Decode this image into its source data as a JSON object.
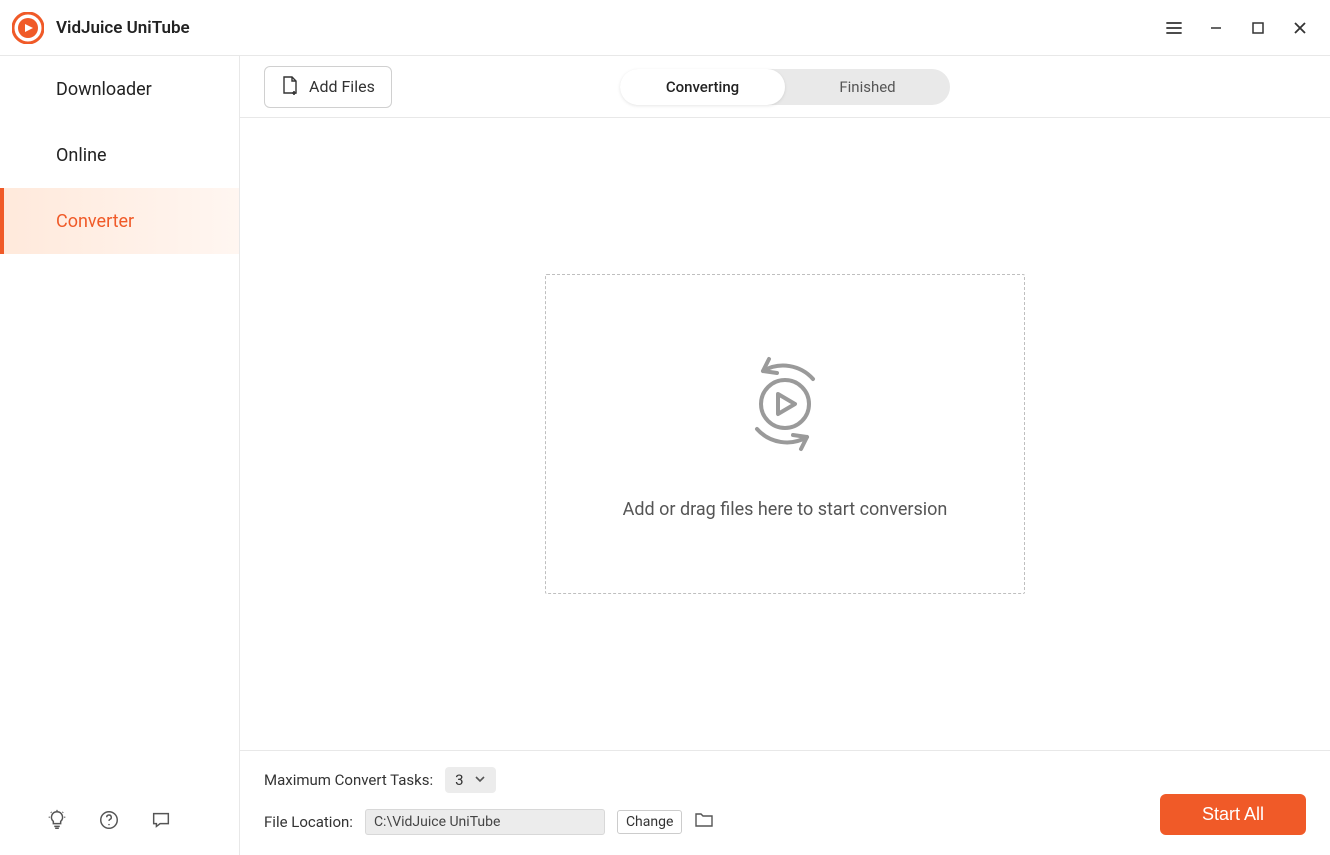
{
  "app_title": "VidJuice UniTube",
  "sidebar": {
    "items": [
      {
        "label": "Downloader",
        "active": false
      },
      {
        "label": "Online",
        "active": false
      },
      {
        "label": "Converter",
        "active": true
      }
    ]
  },
  "toolbar": {
    "add_files_label": "Add Files",
    "tabs": {
      "converting": "Converting",
      "finished": "Finished"
    }
  },
  "dropzone": {
    "hint": "Add or drag files here to start conversion"
  },
  "bottom": {
    "max_tasks_label": "Maximum Convert Tasks:",
    "max_tasks_value": "3",
    "file_location_label": "File Location:",
    "file_location_value": "C:\\VidJuice UniTube",
    "change_label": "Change",
    "start_all_label": "Start All"
  }
}
